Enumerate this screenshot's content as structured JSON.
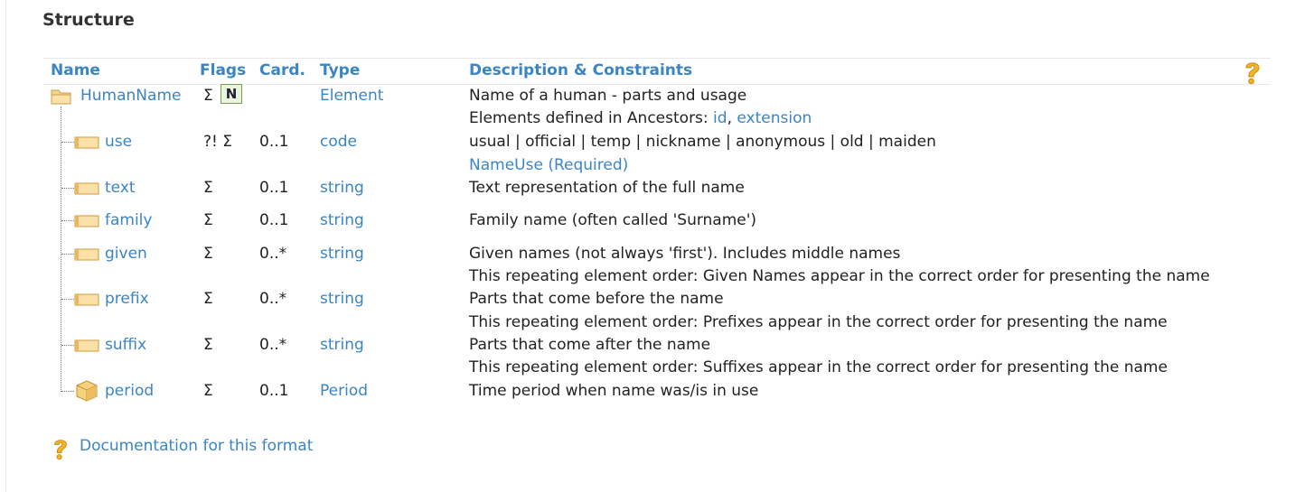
{
  "title": "Structure",
  "headers": {
    "name": "Name",
    "flags": "Flags",
    "card": "Card.",
    "type": "Type",
    "desc": "Description & Constraints"
  },
  "root": {
    "name": "HumanName",
    "flag_sigma": "Σ",
    "flag_n": "N",
    "type": "Element",
    "desc": "Name of a human - parts and usage",
    "ancestors_prefix": "Elements defined in Ancestors: ",
    "ancestor_id": "id",
    "ancestor_comma": ", ",
    "ancestor_extension": "extension"
  },
  "rows": [
    {
      "name": "use",
      "flags": "?! Σ",
      "card": "0..1",
      "type": "code",
      "desc": "usual | official | temp | nickname | anonymous | old | maiden",
      "binding_name": "NameUse",
      "binding_open": " (",
      "binding_strength": "Required",
      "binding_close": ")"
    },
    {
      "name": "text",
      "flags": "Σ",
      "card": "0..1",
      "type": "string",
      "desc": "Text representation of the full name"
    },
    {
      "name": "family",
      "flags": "Σ",
      "card": "0..1",
      "type": "string",
      "desc": "Family name (often called 'Surname')"
    },
    {
      "name": "given",
      "flags": "Σ",
      "card": "0..*",
      "type": "string",
      "desc": "Given names (not always 'first'). Includes middle names",
      "desc2": "This repeating element order: Given Names appear in the correct order for presenting the name"
    },
    {
      "name": "prefix",
      "flags": "Σ",
      "card": "0..*",
      "type": "string",
      "desc": "Parts that come before the name",
      "desc2": "This repeating element order: Prefixes appear in the correct order for presenting the name"
    },
    {
      "name": "suffix",
      "flags": "Σ",
      "card": "0..*",
      "type": "string",
      "desc": "Parts that come after the name",
      "desc2": "This repeating element order: Suffixes appear in the correct order for presenting the name"
    },
    {
      "name": "period",
      "flags": "Σ",
      "card": "0..1",
      "type": "Period",
      "desc": "Time period when name was/is in use"
    }
  ],
  "doc_link": "Documentation for this format",
  "icons": {
    "root": "folder-icon",
    "primitive": "primitive-element-icon",
    "datatype": "datatype-icon",
    "help": "help-icon"
  },
  "colors": {
    "link": "#3a85c6",
    "text": "#222222",
    "badge_bg": "#eaf5dd",
    "badge_border": "#7a9a5a"
  }
}
